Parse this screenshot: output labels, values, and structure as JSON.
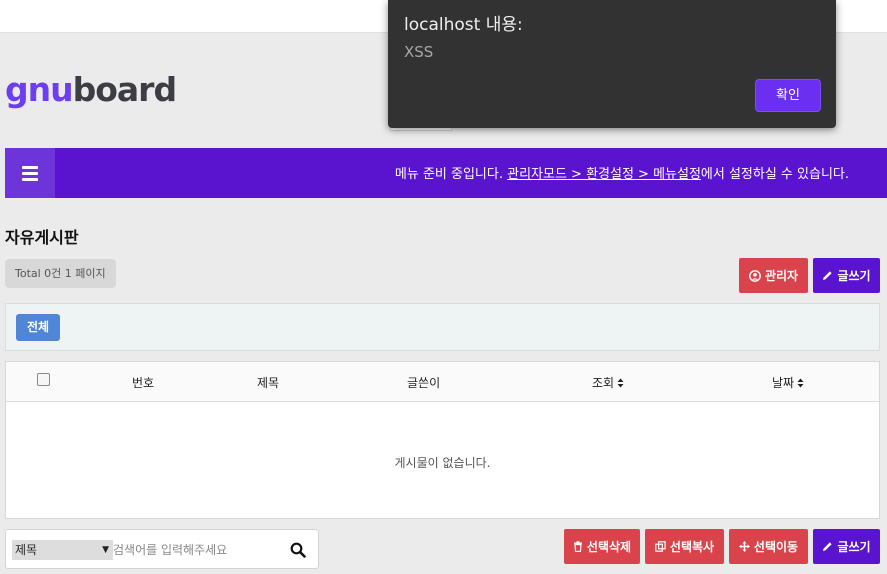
{
  "logo": {
    "part1": "gnu",
    "part2": "board"
  },
  "nav": {
    "message_prefix": "메뉴 준비 중입니다. ",
    "message_link": "관리자모드 > 환경설정 > 메뉴설정",
    "message_suffix": "에서 설정하실 수 있습니다."
  },
  "board": {
    "title": "자유게시판",
    "total": "Total 0건 1 페이지",
    "admin_button": "관리자",
    "write_button": "글쓰기",
    "category_all": "전체"
  },
  "table": {
    "columns": [
      {
        "label": "번호",
        "sortable": false
      },
      {
        "label": "제목",
        "sortable": false
      },
      {
        "label": "글쓴이",
        "sortable": false
      },
      {
        "label": "조회",
        "sortable": true
      },
      {
        "label": "날짜",
        "sortable": true
      }
    ],
    "empty_message": "게시물이 없습니다."
  },
  "search": {
    "field_selected": "제목",
    "placeholder": "검색어를 입력해주세요"
  },
  "actions": {
    "delete": "선택삭제",
    "copy": "선택복사",
    "move": "선택이동",
    "write": "글쓰기"
  },
  "dialog": {
    "title": "localhost 내용:",
    "message": "XSS",
    "ok_button": "확인"
  },
  "colors": {
    "brand_purple": "#5a14cf",
    "danger_red": "#d9434c",
    "category_blue": "#4f86d6"
  }
}
